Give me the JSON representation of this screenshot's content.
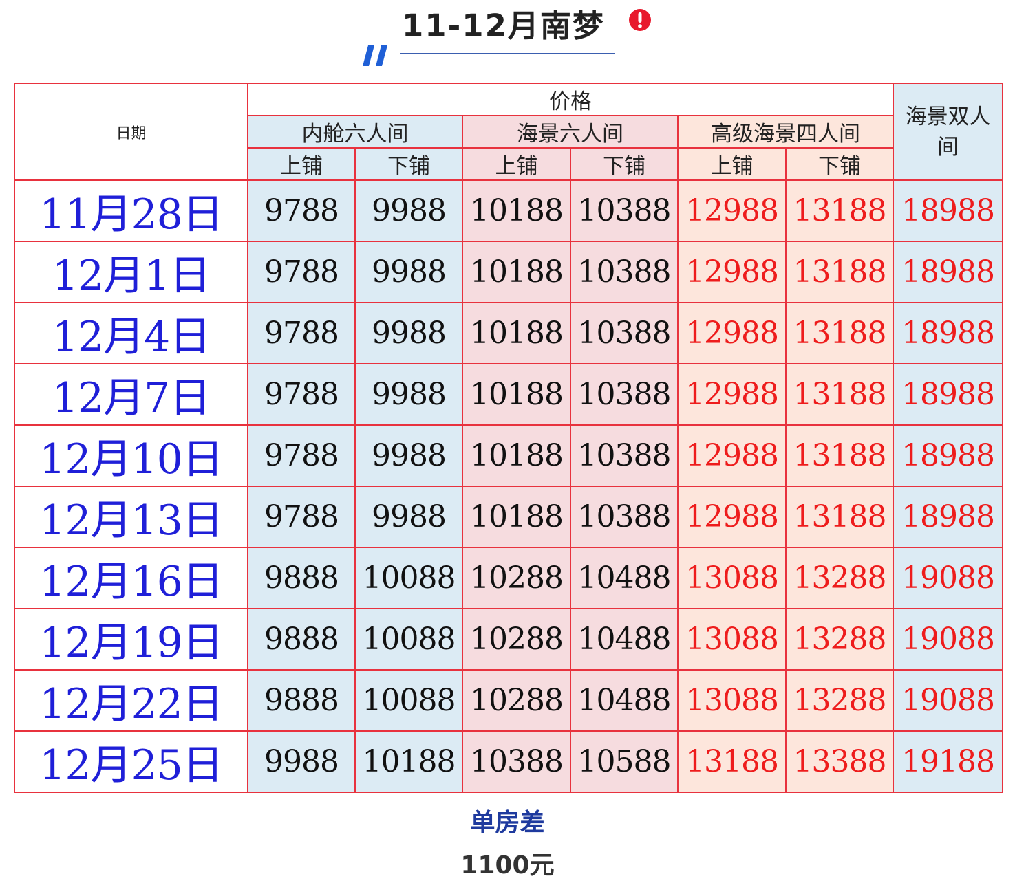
{
  "heading": {
    "title": "11-12月南梦",
    "accent_color": "#1f5fd6",
    "alert_color": "#e8192c",
    "icons": [
      "double-slash-icon",
      "exclamation-circle-icon"
    ]
  },
  "table": {
    "header": {
      "date_label": "日期",
      "price_label": "价格",
      "groups": [
        {
          "name": "内舱六人间",
          "berths": [
            "上铺",
            "下铺"
          ]
        },
        {
          "name": "海景六人间",
          "berths": [
            "上铺",
            "下铺"
          ]
        },
        {
          "name": "高级海景四人间",
          "berths": [
            "上铺",
            "下铺"
          ]
        }
      ],
      "double_room_line1": "海景双人",
      "double_room_line2": "间"
    },
    "rows": [
      {
        "date": "11月28日",
        "prices": [
          "9788",
          "9988",
          "10188",
          "10388",
          "12988",
          "13188",
          "18988"
        ]
      },
      {
        "date": "12月1日",
        "prices": [
          "9788",
          "9988",
          "10188",
          "10388",
          "12988",
          "13188",
          "18988"
        ]
      },
      {
        "date": "12月4日",
        "prices": [
          "9788",
          "9988",
          "10188",
          "10388",
          "12988",
          "13188",
          "18988"
        ]
      },
      {
        "date": "12月7日",
        "prices": [
          "9788",
          "9988",
          "10188",
          "10388",
          "12988",
          "13188",
          "18988"
        ]
      },
      {
        "date": "12月10日",
        "prices": [
          "9788",
          "9988",
          "10188",
          "10388",
          "12988",
          "13188",
          "18988"
        ]
      },
      {
        "date": "12月13日",
        "prices": [
          "9788",
          "9988",
          "10188",
          "10388",
          "12988",
          "13188",
          "18988"
        ]
      },
      {
        "date": "12月16日",
        "prices": [
          "9888",
          "10088",
          "10288",
          "10488",
          "13088",
          "13288",
          "19088"
        ]
      },
      {
        "date": "12月19日",
        "prices": [
          "9888",
          "10088",
          "10288",
          "10488",
          "13088",
          "13288",
          "19088"
        ]
      },
      {
        "date": "12月22日",
        "prices": [
          "9888",
          "10088",
          "10288",
          "10488",
          "13088",
          "13288",
          "19088"
        ]
      },
      {
        "date": "12月25日",
        "prices": [
          "9988",
          "10188",
          "10388",
          "10588",
          "13188",
          "13388",
          "19188"
        ]
      }
    ],
    "colors": {
      "border": "#e8323e",
      "date_text": "#1f1fd8",
      "price_black": "#111111",
      "price_red": "#ee1c1c",
      "blue_bg": "#dcebf4",
      "pink_bg": "#f6dcdf",
      "peach_bg": "#fde6dc"
    }
  },
  "footer": {
    "label": "单房差",
    "value": "1100元"
  }
}
